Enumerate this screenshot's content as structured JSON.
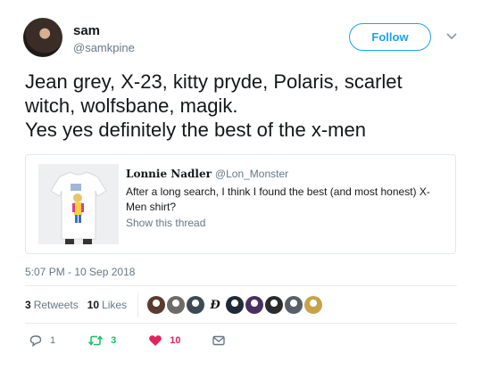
{
  "author": {
    "name": "sam",
    "handle": "@samkpine",
    "avatar_icon": "profile-photo"
  },
  "follow_button": {
    "label": "Follow"
  },
  "tweet": {
    "lines": [
      "Jean grey, X-23, kitty pryde, Polaris, scarlet",
      "witch, wolfsbane, magik.",
      "Yes yes definitely the best of the x-men"
    ]
  },
  "quoted_tweet": {
    "name": "Lonnie Nadler",
    "handle": "@Lon_Monster",
    "text": "After a long search, I think I found the best (and most honest) X-Men shirt?",
    "show_thread": "Show this thread",
    "image_icon": "tshirt-image"
  },
  "timestamp": "5:07 PM - 10 Sep 2018",
  "stats": {
    "retweets_count": "3",
    "retweets_label": "Retweets",
    "likes_count": "10",
    "likes_label": "Likes"
  },
  "likers": [
    {
      "color": "#5a3b2e"
    },
    {
      "color": "#6e6a66"
    },
    {
      "color": "#3d4a55"
    },
    {
      "letter": "Ð"
    },
    {
      "color": "#1f2a38"
    },
    {
      "color": "#4b2f5e"
    },
    {
      "color": "#2b2b2b"
    },
    {
      "color": "#55606a"
    },
    {
      "color": "#c9a14a"
    }
  ],
  "actions": {
    "reply_count": "1",
    "retweet_count": "3",
    "like_count": "10"
  },
  "colors": {
    "accent": "#1da1f2",
    "retweet": "#17bf63",
    "like": "#e0245e",
    "muted": "#657786"
  }
}
